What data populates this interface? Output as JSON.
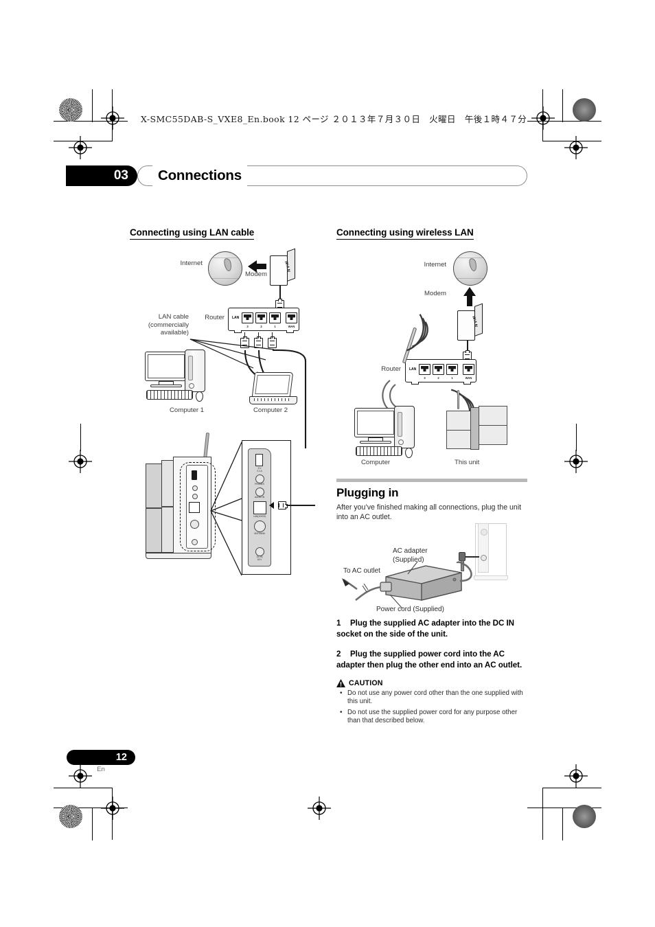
{
  "document": {
    "file_header": "X-SMC55DAB-S_VXE8_En.book   12 ページ   ２０１３年７月３０日　火曜日　午後１時４７分",
    "chapter_number": "03",
    "chapter_title": "Connections",
    "page_number": "12",
    "page_language": "En"
  },
  "left_column": {
    "heading": "Connecting using LAN cable",
    "diagram": {
      "internet_label": "Internet",
      "modem_label": "Modem",
      "modem_port_label": "WAN",
      "router_label": "Router",
      "router_lan_label": "LAN",
      "router_ports": [
        "3",
        "2",
        "1"
      ],
      "router_wan_label": "WAN",
      "lan_cable_label": "LAN cable\n(commercially\navailable)",
      "lan_cable_line1": "LAN cable",
      "lan_cable_line2": "(commercially",
      "lan_cable_line3": "available)",
      "computer1_label": "Computer 1",
      "computer2_label": "Computer 2",
      "unit_ports": [
        "5 V\n2.1 A",
        "PHONES",
        "AUDIO IN",
        "LAN(10/100)",
        "ANTENNA",
        "DC IN\n18 V"
      ],
      "unit_port_usb_l1": "5 V",
      "unit_port_usb_l2": "2.1 A",
      "unit_port_phones": "PHONES",
      "unit_port_audio_in": "AUDIO IN",
      "unit_port_lan": "LAN(10/100)",
      "unit_port_antenna": "ANTENNA",
      "unit_port_dcin_l1": "DC IN",
      "unit_port_dcin_l2": "18 V"
    }
  },
  "right_column": {
    "heading": "Connecting using wireless LAN",
    "diagram": {
      "internet_label": "Internet",
      "modem_label": "Modem",
      "modem_port_label": "WAN",
      "router_label": "Router",
      "router_lan_label": "LAN",
      "router_ports": [
        "3",
        "2",
        "1"
      ],
      "router_wan_label": "WAN",
      "computer_label": "Computer",
      "this_unit_label": "This unit"
    },
    "plugging_in": {
      "heading": "Plugging in",
      "intro": "After you’ve finished making all connections, plug the unit into an AC outlet.",
      "diagram": {
        "to_ac_outlet_label": "To AC outlet",
        "ac_adapter_label_l1": "AC adapter",
        "ac_adapter_label_l2": "(Supplied)",
        "power_cord_label": "Power cord (Supplied)"
      },
      "steps": [
        {
          "number": "1",
          "text": "Plug the supplied AC adapter into the DC IN socket on the side of the unit."
        },
        {
          "number": "2",
          "text": "Plug the supplied power cord into the AC adapter then plug the other end into an AC outlet."
        }
      ],
      "caution": {
        "title": "CAUTION",
        "icon": "warning-triangle-icon",
        "items": [
          "Do not use any power cord other than the one supplied with this unit.",
          "Do not use the supplied power cord for any purpose other than that described below."
        ]
      }
    }
  },
  "colors": {
    "ink": "#000000",
    "body_text": "#2b2b2b",
    "diagram_label": "#3b3b3b",
    "rule_gray": "#b9b9b9",
    "chapter_box_border": "#8e8e8e"
  }
}
